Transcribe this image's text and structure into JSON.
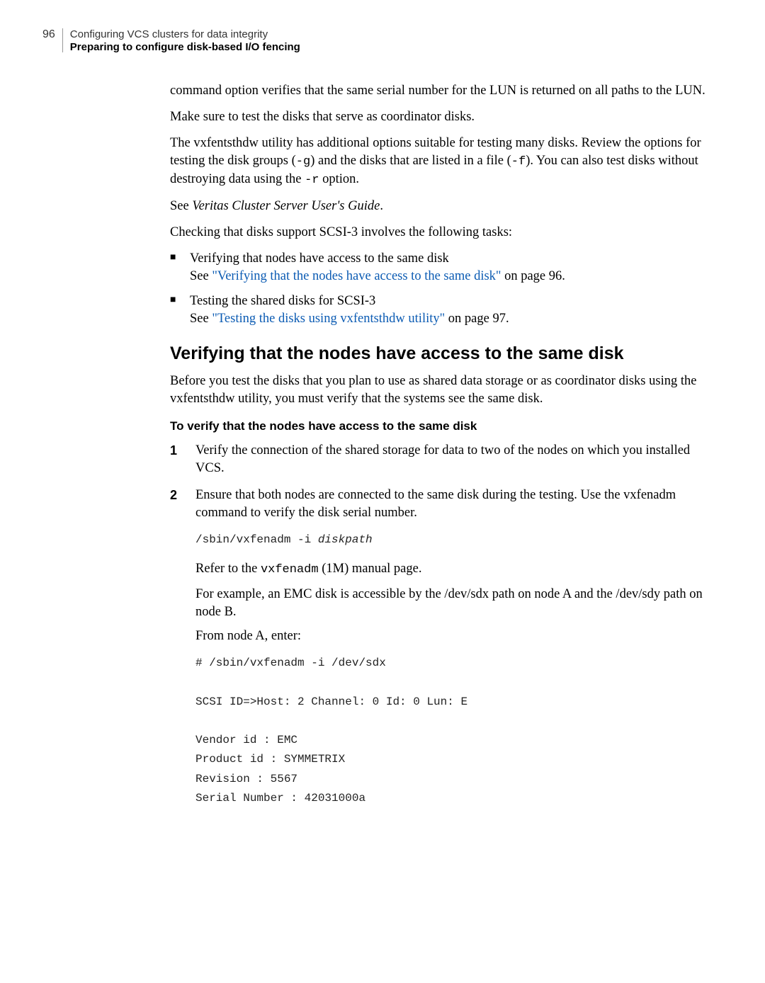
{
  "header": {
    "page_number": "96",
    "chapter": "Configuring VCS clusters for data integrity",
    "section": "Preparing to configure disk-based I/O fencing"
  },
  "para1": "command option verifies that the same serial number for the LUN is returned on all paths to the LUN.",
  "para2": "Make sure to test the disks that serve as coordinator disks.",
  "para3_a": "The vxfentsthdw utility has additional options suitable for testing many disks. Review the options for testing the disk groups (",
  "para3_g": "-g",
  "para3_b": ") and the disks that are listed in a file (",
  "para3_f": "-f",
  "para3_c": "). You can also test disks without destroying data using the ",
  "para3_r": "-r",
  "para3_d": " option.",
  "para4_a": "See ",
  "para4_i": "Veritas Cluster Server User's Guide",
  "para4_b": ".",
  "para5": "Checking that disks support SCSI-3 involves the following tasks:",
  "bullet1_a": "Verifying that nodes have access to the same disk",
  "bullet1_see": "See ",
  "bullet1_link": "\"Verifying that the nodes have access to the same disk\"",
  "bullet1_end": " on page 96.",
  "bullet2_a": "Testing the shared disks for SCSI-3",
  "bullet2_see": "See ",
  "bullet2_link": "\"Testing the disks using vxfentsthdw utility\"",
  "bullet2_end": " on page 97.",
  "h2": "Verifying that the nodes have access to the same disk",
  "para6": "Before you test the disks that you plan to use as shared data storage or as coordinator disks using the vxfentsthdw utility, you must verify that the systems see the same disk.",
  "proc_title": "To verify that the nodes have access to the same disk",
  "step1_num": "1",
  "step1": "Verify the connection of the shared storage for data to two of the nodes on which you installed VCS.",
  "step2_num": "2",
  "step2_a": "Ensure that both nodes are connected to the same disk during the testing. Use the vxfenadm command to verify the disk serial number.",
  "code1_a": "/sbin/vxfenadm -i ",
  "code1_b": "diskpath",
  "step2_b_a": "Refer to the ",
  "step2_b_mono": "vxfenadm",
  "step2_b_b": " (1M) manual page.",
  "step2_c": "For example, an EMC disk is accessible by the /dev/sdx path on node A and the /dev/sdy path on node B.",
  "step2_d": "From node A, enter:",
  "code2": "# /sbin/vxfenadm -i /dev/sdx\n\nSCSI ID=>Host: 2 Channel: 0 Id: 0 Lun: E\n\nVendor id : EMC\nProduct id : SYMMETRIX\nRevision : 5567\nSerial Number : 42031000a"
}
